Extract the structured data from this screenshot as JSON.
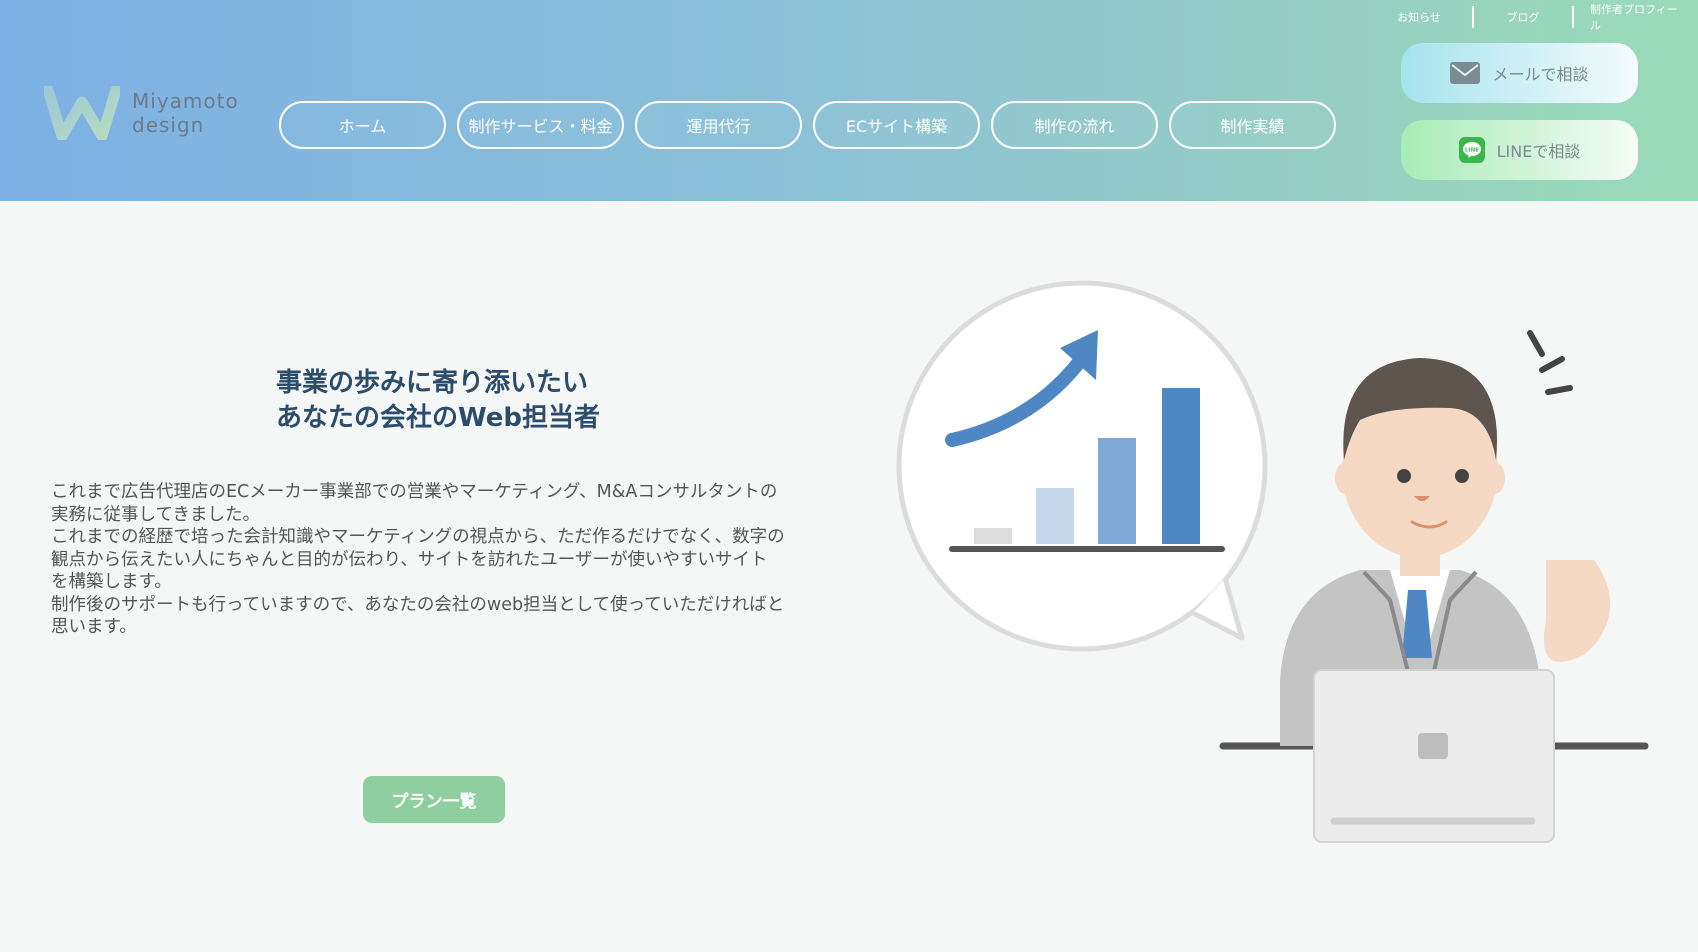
{
  "brand": {
    "logo_line1": "Miyamoto",
    "logo_line2": "design",
    "accent": "#7db0e4",
    "green": "#8fce9f"
  },
  "toplinks": [
    "お知らせ",
    "ブログ",
    "制作者プロフィール"
  ],
  "nav": [
    "ホーム",
    "制作サービス・料金",
    "運用代行",
    "ECサイト構築",
    "制作の流れ",
    "制作実績"
  ],
  "cta": {
    "mail": "メールで相談",
    "line": "LINEで相談",
    "mail_icon": "mail-icon",
    "line_icon": "line-icon"
  },
  "hero": {
    "headline": [
      "事業の歩みに寄り添いたい",
      "あなたの会社のWeb担当者"
    ],
    "description": [
      "これまで広告代理店のECメーカー事業部での営業やマーケティング、M&Aコンサルタントの",
      "実務に従事してきました。",
      "これまでの経歴で培った会計知識やマーケティングの視点から、ただ作るだけでなく、数字の",
      "観点から伝えたい人にちゃんと目的が伝わり、サイトを訪れたユーザーが使いやすいサイト",
      "を構築します。",
      "制作後のサポートも行っていますので、あなたの会社のweb担当として使っていただければと",
      "思います。"
    ],
    "plan_button": "プラン一覧"
  }
}
